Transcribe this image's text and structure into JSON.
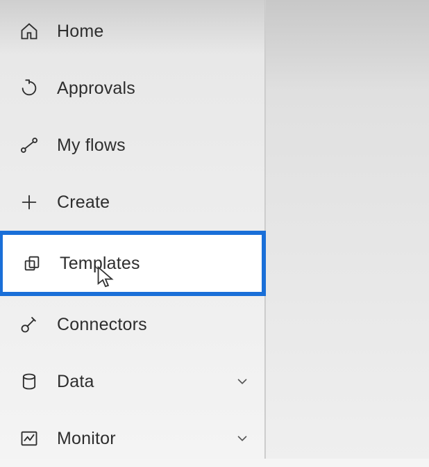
{
  "sidebar": {
    "items": [
      {
        "label": "Home"
      },
      {
        "label": "Approvals"
      },
      {
        "label": "My flows"
      },
      {
        "label": "Create"
      },
      {
        "label": "Templates"
      },
      {
        "label": "Connectors"
      },
      {
        "label": "Data"
      },
      {
        "label": "Monitor"
      }
    ]
  },
  "colors": {
    "highlight": "#1a6fd8"
  }
}
